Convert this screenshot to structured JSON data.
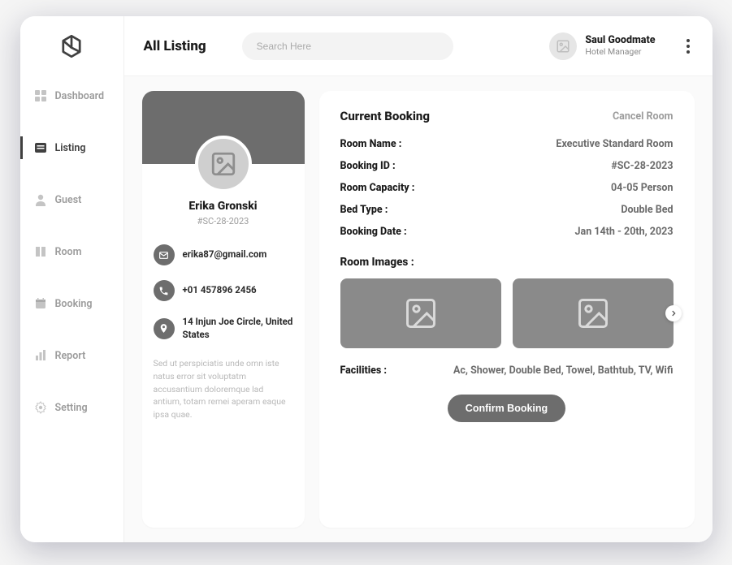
{
  "page_title": "All Listing",
  "search": {
    "placeholder": "Search Here"
  },
  "user": {
    "name": "Saul Goodmate",
    "role": "Hotel Manager"
  },
  "nav": {
    "dashboard": "Dashboard",
    "listing": "Listing",
    "guest": "Guest",
    "room": "Room",
    "booking": "Booking",
    "report": "Report",
    "setting": "Setting"
  },
  "profile": {
    "name": "Erika Gronski",
    "id": "#SC-28-2023",
    "email": "erika87@gmail.com",
    "phone": "+01 457896 2456",
    "address": "14 Injun Joe Circle, United States",
    "notes": "Sed ut perspiciatis unde omn iste natus error sit voluptatm accusantium doloremque lad antium, totam remei aperam eaque ipsa quae."
  },
  "booking": {
    "title": "Current Booking",
    "cancel": "Cancel Room",
    "labels": {
      "room_name": "Room Name :",
      "booking_id": "Booking ID :",
      "capacity": "Room Capacity :",
      "bed_type": "Bed Type :",
      "booking_date": "Booking Date :",
      "images": "Room Images :",
      "facilities": "Facilities :"
    },
    "values": {
      "room_name": "Executive Standard Room",
      "booking_id": "#SC-28-2023",
      "capacity": "04-05 Person",
      "bed_type": "Double Bed",
      "booking_date": "Jan 14th - 20th, 2023",
      "facilities": "Ac, Shower, Double Bed, Towel, Bathtub, TV, Wifi"
    },
    "confirm": "Confirm Booking"
  }
}
